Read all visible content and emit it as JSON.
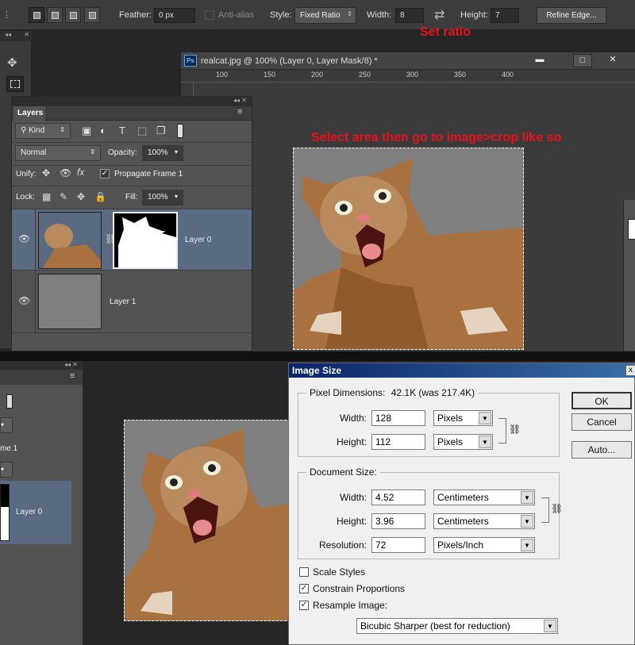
{
  "options_bar": {
    "feather_label": "Feather:",
    "feather_value": "0 px",
    "antialias_label": "Anti-alias",
    "style_label": "Style:",
    "style_value": "Fixed Ratio",
    "width_label": "Width:",
    "width_value": "8",
    "height_label": "Height:",
    "height_value": "7",
    "refine_edge_label": "Refine Edge...",
    "annotation": "Set ratio"
  },
  "document": {
    "title": "realcat.jpg @ 100% (Layer 0, Layer Mask/8) *",
    "ps_badge": "Ps",
    "ruler_ticks": [
      "100",
      "150",
      "200",
      "250",
      "300",
      "350",
      "400"
    ],
    "annotation": "Select area then go to image>crop like so"
  },
  "layers_panel": {
    "tab_label": "Layers",
    "kind_label": "Kind",
    "blend_mode": "Normal",
    "opacity_label": "Opacity:",
    "opacity_value": "100%",
    "unify_label": "Unify:",
    "propagate_label": "Propagate Frame 1",
    "lock_label": "Lock:",
    "fill_label": "Fill:",
    "fill_value": "100%",
    "layers": [
      {
        "name": "Layer 0"
      },
      {
        "name": "Layer 1"
      }
    ]
  },
  "bottom_left": {
    "partial_frame": "me 1",
    "layer_name": "Layer 0"
  },
  "image_size_dialog": {
    "title": "Image Size",
    "pixel_dimensions_label": "Pixel Dimensions:",
    "pixel_dimensions_value": "42.1K (was 217.4K)",
    "width_label": "Width:",
    "height_label": "Height:",
    "px_width": "128",
    "px_height": "112",
    "px_unit": "Pixels",
    "document_size_label": "Document Size:",
    "doc_width": "4.52",
    "doc_height": "3.96",
    "doc_unit": "Centimeters",
    "resolution_label": "Resolution:",
    "resolution": "72",
    "resolution_unit": "Pixels/Inch",
    "scale_styles": "Scale Styles",
    "constrain": "Constrain Proportions",
    "resample": "Resample Image:",
    "resample_method": "Bicubic Sharper (best for reduction)",
    "ok": "OK",
    "cancel": "Cancel",
    "auto": "Auto...",
    "close": "x"
  }
}
